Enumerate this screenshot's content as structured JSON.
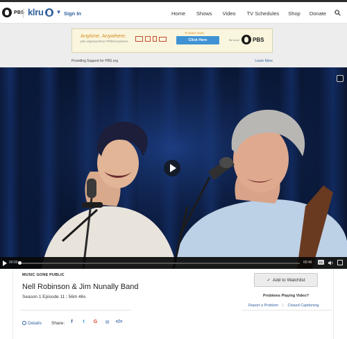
{
  "header": {
    "brand": "PBS",
    "station": "klru",
    "signin": "Sign In",
    "nav": [
      "Home",
      "Shows",
      "Video",
      "TV Schedules",
      "Shop",
      "Donate"
    ],
    "search_icon": "search-icon"
  },
  "ad": {
    "headline": "Anytime. Anywhere.",
    "subline": "pbs.org/anywhere  #PBSAnywhere",
    "to_learn": "To learn more:",
    "cta": "Click Here",
    "be_more": "Be more",
    "pbs": "PBS",
    "support": "Providing Support for PBS.org",
    "learn_more": "Learn More"
  },
  "player": {
    "current_time": "00:00",
    "duration": "00:46",
    "progress": 0.0,
    "cc": "CC",
    "play_icon": "play-icon"
  },
  "episode": {
    "show": "MUSIC GONE PUBLIC",
    "title": "Nell Robinson & Jim Nunally Band",
    "season_episode": "Season 1 Episode 11",
    "separator": "|",
    "length": "56m 46s",
    "details": "Details",
    "share_label": "Share:",
    "share": {
      "facebook": "f",
      "twitter": "t",
      "google": "G",
      "email": "✉",
      "embed": "</>"
    },
    "watchlist": "Add to Watchlist",
    "watchlist_icon": "✓",
    "problems": "Problems Playing Video?",
    "report": "Report a Problem",
    "link_sep": "|",
    "captioning": "Closed Captioning"
  }
}
